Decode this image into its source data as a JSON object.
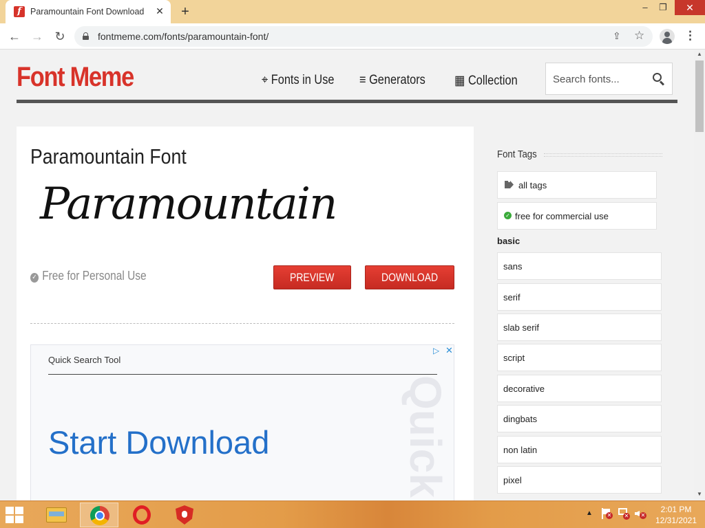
{
  "browser": {
    "tab_title": "Paramountain Font Download",
    "favicon_letter": "f",
    "url": "fontmeme.com/fonts/paramountain-font/",
    "tab_close": "✕",
    "new_tab": "+",
    "window_min": "–",
    "window_max": "❐",
    "window_close": "✕",
    "nav_back": "←",
    "nav_forward": "→",
    "nav_reload": "↻",
    "menu": "⋮"
  },
  "site": {
    "logo": "Font Meme",
    "nav": {
      "fonts_in_use": "Fonts in Use",
      "generators": "Generators",
      "collection": "Collection"
    },
    "nav_icons": {
      "fonts_in_use": "⌖",
      "generators": "≡",
      "collection": "▦"
    },
    "search_placeholder": "Search fonts..."
  },
  "main": {
    "title": "Paramountain Font",
    "sample_text": "Paramountain",
    "license": "Free for Personal Use",
    "preview_button": "PREVIEW",
    "download_button": "DOWNLOAD"
  },
  "ad": {
    "label": "Quick Search Tool",
    "cta": "Start Download",
    "watermark": "Quick",
    "choices_icon": "▷",
    "close_icon": "✕"
  },
  "sidebar": {
    "heading": "Font Tags",
    "all_tags": "all tags",
    "commercial": "free for commercial use",
    "section": "basic",
    "categories": [
      "sans",
      "serif",
      "slab serif",
      "script",
      "decorative",
      "dingbats",
      "non latin",
      "pixel"
    ]
  },
  "taskbar": {
    "time": "2:01 PM",
    "date": "12/31/2021"
  },
  "colors": {
    "brand_red": "#d8332a",
    "ad_blue": "#2470c9",
    "tab_strip": "#f2d49a"
  }
}
